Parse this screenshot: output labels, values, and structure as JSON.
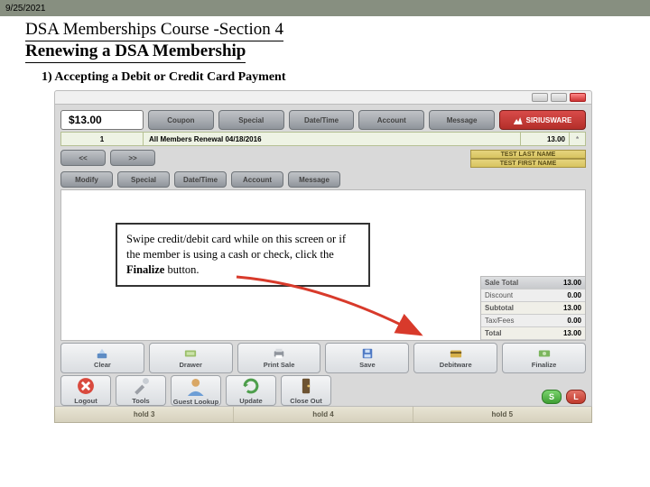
{
  "date": "9/25/2021",
  "title_line1": "DSA Memberships Course -Section 4",
  "title_line2": "Renewing a DSA Membership",
  "step_label": "1) Accepting a Debit or Credit Card Payment",
  "price": "$13.00",
  "top_buttons": {
    "b1": "Coupon",
    "b2": "Special",
    "b3": "Date/Time",
    "b4": "Account",
    "b5": "Message"
  },
  "logo_label": "SIRIUSWARE",
  "line_item": {
    "qty": "1",
    "desc": "All Members Renewal 04/18/2016",
    "price": "13.00",
    "star": "*"
  },
  "nav": {
    "prev": "<<",
    "next": ">>",
    "modify": "Modify",
    "special": "Special",
    "datetime": "Date/Time",
    "account": "Account",
    "message": "Message"
  },
  "member": {
    "last": "TEST LAST NAME",
    "first": "TEST FIRST NAME"
  },
  "callout_text": "Swipe credit/debit card while on this screen or if the member is using a cash or check, click the ",
  "callout_bold": "Finalize",
  "callout_tail": " button.",
  "totals": {
    "sale_total_label": "Sale Total",
    "sale_total": "13.00",
    "discount_label": "Discount",
    "discount": "0.00",
    "subtotal_label": "Subtotal",
    "subtotal": "13.00",
    "taxfees_label": "Tax/Fees",
    "taxfees": "0.00",
    "total_label": "Total",
    "total": "13.00"
  },
  "actions": {
    "clear": "Clear",
    "drawer": "Drawer",
    "printsale": "Print Sale",
    "save": "Save",
    "debitware": "Debitware",
    "finalize": "Finalize"
  },
  "actions2": {
    "logout": "Logout",
    "tools": "Tools",
    "guest": "Guest Lookup",
    "update": "Update",
    "closeout": "Close Out"
  },
  "sl": {
    "s": "S",
    "l": "L"
  },
  "holds": {
    "h3": "hold 3",
    "h4": "hold 4",
    "h5": "hold 5"
  }
}
